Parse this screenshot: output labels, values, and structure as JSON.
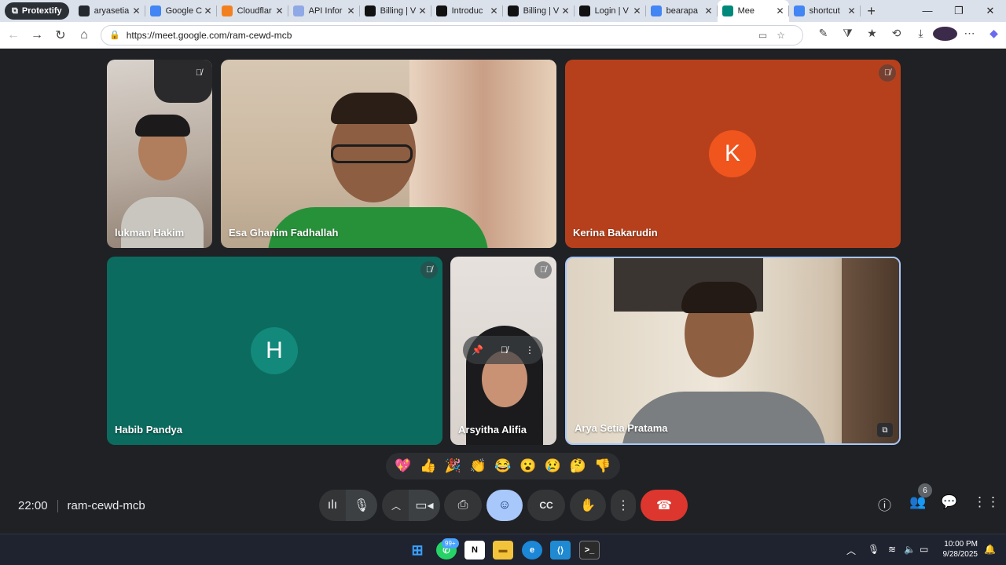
{
  "browser": {
    "profile_label": "Protextify",
    "tabs": [
      {
        "title": "aryasetia",
        "icon": "github-icon",
        "color": "#24292f"
      },
      {
        "title": "Google C",
        "icon": "gemini-icon",
        "color": "#4285f4"
      },
      {
        "title": "Cloudflar",
        "icon": "cloudflare-icon",
        "color": "#f38020"
      },
      {
        "title": "API Infor",
        "icon": "wordpress-icon",
        "color": "#8fa9e6"
      },
      {
        "title": "Billing | V",
        "icon": "wordpress-icon",
        "color": "#111"
      },
      {
        "title": "Introduc",
        "icon": "wordpress-icon",
        "color": "#111"
      },
      {
        "title": "Billing | V",
        "icon": "wordpress-icon",
        "color": "#111"
      },
      {
        "title": "Login | V",
        "icon": "wordpress-icon",
        "color": "#111"
      },
      {
        "title": "bearapa",
        "icon": "google-icon",
        "color": "#4285f4"
      },
      {
        "title": "Mee",
        "icon": "meet-icon",
        "color": "#00897b"
      },
      {
        "title": "shortcut",
        "icon": "google-icon",
        "color": "#4285f4"
      }
    ],
    "url": "https://meet.google.com/ram-cewd-mcb"
  },
  "participants": [
    {
      "name": "lukman Hakim",
      "muted": true
    },
    {
      "name": "Esa Ghanim Fadhallah",
      "muted": false
    },
    {
      "name": "Kerina Bakarudin",
      "muted": true,
      "initial": "K",
      "tile_color": "#b7401c",
      "avatar_color": "#f0551e"
    },
    {
      "name": "Habib Pandya",
      "muted": true,
      "initial": "H",
      "tile_color": "#0b6b5f",
      "avatar_color": "#13897b"
    },
    {
      "name": "Arsyitha Alifia",
      "muted": true
    },
    {
      "name": "Arya Setia Pratama",
      "muted": false
    }
  ],
  "reactions": [
    "💖",
    "👍",
    "🎉",
    "👏",
    "😂",
    "😮",
    "😢",
    "🤔",
    "👎"
  ],
  "meeting": {
    "time": "22:00",
    "code": "ram-cewd-mcb",
    "people_count": "6"
  },
  "taskbar": {
    "whatsapp_badge": "99+",
    "time": "10:00 PM",
    "date": "9/28/2025"
  }
}
